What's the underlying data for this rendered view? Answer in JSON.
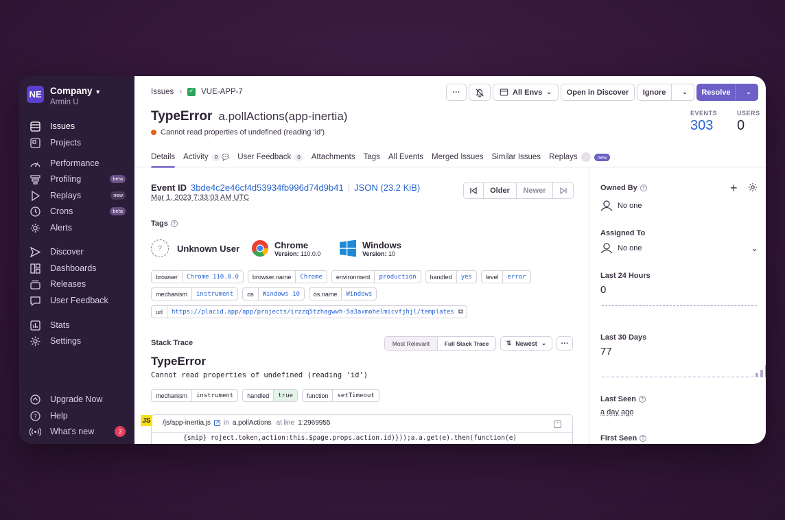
{
  "sidebar": {
    "org": {
      "initials": "NE",
      "name": "Company",
      "user": "Armin U"
    },
    "items": [
      {
        "label": "Issues",
        "icon": "issues-icon"
      },
      {
        "label": "Projects",
        "icon": "projects-icon"
      },
      {
        "label": "Performance",
        "icon": "performance-icon"
      },
      {
        "label": "Profiling",
        "icon": "profiling-icon",
        "badge": "beta"
      },
      {
        "label": "Replays",
        "icon": "replays-icon",
        "badge": "new"
      },
      {
        "label": "Crons",
        "icon": "crons-icon",
        "badge": "beta"
      },
      {
        "label": "Alerts",
        "icon": "alerts-icon"
      },
      {
        "label": "Discover",
        "icon": "discover-icon"
      },
      {
        "label": "Dashboards",
        "icon": "dashboards-icon"
      },
      {
        "label": "Releases",
        "icon": "releases-icon"
      },
      {
        "label": "User Feedback",
        "icon": "user-feedback-icon"
      },
      {
        "label": "Stats",
        "icon": "stats-icon"
      },
      {
        "label": "Settings",
        "icon": "settings-icon"
      }
    ],
    "footer": [
      {
        "label": "Upgrade Now",
        "icon": "upgrade-icon"
      },
      {
        "label": "Help",
        "icon": "help-icon"
      },
      {
        "label": "What's new",
        "icon": "broadcast-icon",
        "count": "3"
      }
    ]
  },
  "header": {
    "breadcrumb": {
      "root": "Issues",
      "project": "VUE-APP-7"
    },
    "actions": {
      "more": "···",
      "env": "All Envs",
      "open_discover": "Open in Discover",
      "ignore": "Ignore",
      "resolve": "Resolve"
    },
    "error_type": "TypeError",
    "error_func": "a.pollActions(app-inertia)",
    "message": "Cannot read properties of undefined (reading 'id')",
    "stats": {
      "events_label": "EVENTS",
      "events": "303",
      "users_label": "USERS",
      "users": "0"
    },
    "tabs": [
      {
        "label": "Details"
      },
      {
        "label": "Activity",
        "badge": "0"
      },
      {
        "label": "User Feedback",
        "badge": "0"
      },
      {
        "label": "Attachments"
      },
      {
        "label": "Tags"
      },
      {
        "label": "All Events"
      },
      {
        "label": "Merged Issues"
      },
      {
        "label": "Similar Issues"
      },
      {
        "label": "Replays",
        "badge": "new"
      }
    ]
  },
  "event": {
    "id_label": "Event ID",
    "id": "3bde4c2e46cf4d53934fb996d74d9b41",
    "json": "JSON (23.2 KiB)",
    "date": "Mar 1, 2023 7:33:03 AM UTC",
    "nav": {
      "older": "Older",
      "newer": "Newer"
    }
  },
  "tags_section": {
    "title": "Tags",
    "contexts": [
      {
        "name": "Unknown User",
        "icon": "unknown-user-icon"
      },
      {
        "name": "Chrome",
        "version_label": "Version:",
        "version": "110.0.0",
        "icon": "chrome-icon"
      },
      {
        "name": "Windows",
        "version_label": "Version:",
        "version": "10",
        "icon": "windows-icon"
      }
    ],
    "tags_row1": [
      {
        "k": "browser",
        "v": "Chrome 110.0.0"
      },
      {
        "k": "browser.name",
        "v": "Chrome"
      },
      {
        "k": "environment",
        "v": "production"
      },
      {
        "k": "handled",
        "v": "yes"
      },
      {
        "k": "level",
        "v": "error"
      }
    ],
    "tags_row2": [
      {
        "k": "mechanism",
        "v": "instrument"
      },
      {
        "k": "os",
        "v": "Windows 10"
      },
      {
        "k": "os.name",
        "v": "Windows"
      }
    ],
    "tags_row3": [
      {
        "k": "url",
        "v": "https://placid.app/app/projects/irzzq5tzhagwwh-5a3axmohelmicvfjhjl/templates"
      }
    ]
  },
  "stack": {
    "title": "Stack Trace",
    "most_relevant": "Most Relevant",
    "full": "Full Stack Trace",
    "sort": "Newest",
    "exc_type": "TypeError",
    "exc_value": "Cannot read properties of undefined (reading 'id')",
    "mech_tags": [
      {
        "k": "mechanism",
        "v": "instrument"
      },
      {
        "k": "handled",
        "v": "true"
      },
      {
        "k": "function",
        "v": "setTimeout"
      }
    ],
    "frame": {
      "file": "/js/app-inertia.js",
      "in": "in",
      "func": "a.pollActions",
      "at_line": "at line",
      "line": "1:2969955",
      "code": "{snip} roject.token,action:this.$page.props.action.id)}));a.a.get(e).then(function(e)",
      "js": "JS"
    }
  },
  "right": {
    "owned_by": "Owned By",
    "owned_val": "No one",
    "assigned_to": "Assigned To",
    "assigned_val": "No one",
    "last24": "Last 24 Hours",
    "last24_val": "0",
    "last30": "Last 30 Days",
    "last30_val": "77",
    "last30_bars": [
      0,
      0,
      0,
      0,
      0,
      0,
      0,
      0,
      0,
      0,
      0,
      0,
      0,
      0,
      0,
      0,
      0,
      0,
      0,
      0,
      0,
      0,
      0,
      0,
      0,
      0,
      0,
      0,
      0,
      0,
      0,
      0,
      3,
      6,
      10,
      4,
      12,
      2,
      1,
      8,
      3,
      2,
      10,
      4,
      3,
      2
    ],
    "last_seen": "Last Seen",
    "last_seen_val": "a day ago",
    "first_seen": "First Seen"
  }
}
